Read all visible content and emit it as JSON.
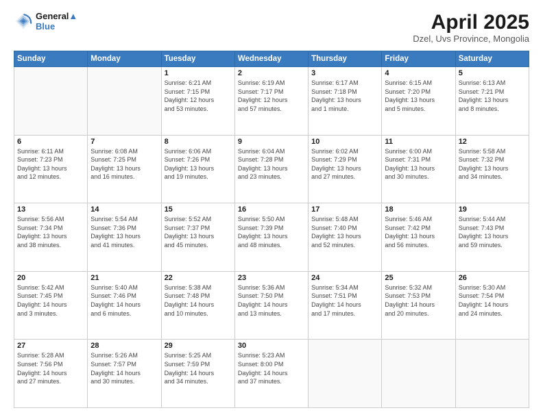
{
  "header": {
    "logo_line1": "General",
    "logo_line2": "Blue",
    "title": "April 2025",
    "subtitle": "Dzel, Uvs Province, Mongolia"
  },
  "calendar": {
    "days_of_week": [
      "Sunday",
      "Monday",
      "Tuesday",
      "Wednesday",
      "Thursday",
      "Friday",
      "Saturday"
    ],
    "weeks": [
      [
        {
          "day": "",
          "info": ""
        },
        {
          "day": "",
          "info": ""
        },
        {
          "day": "1",
          "info": "Sunrise: 6:21 AM\nSunset: 7:15 PM\nDaylight: 12 hours\nand 53 minutes."
        },
        {
          "day": "2",
          "info": "Sunrise: 6:19 AM\nSunset: 7:17 PM\nDaylight: 12 hours\nand 57 minutes."
        },
        {
          "day": "3",
          "info": "Sunrise: 6:17 AM\nSunset: 7:18 PM\nDaylight: 13 hours\nand 1 minute."
        },
        {
          "day": "4",
          "info": "Sunrise: 6:15 AM\nSunset: 7:20 PM\nDaylight: 13 hours\nand 5 minutes."
        },
        {
          "day": "5",
          "info": "Sunrise: 6:13 AM\nSunset: 7:21 PM\nDaylight: 13 hours\nand 8 minutes."
        }
      ],
      [
        {
          "day": "6",
          "info": "Sunrise: 6:11 AM\nSunset: 7:23 PM\nDaylight: 13 hours\nand 12 minutes."
        },
        {
          "day": "7",
          "info": "Sunrise: 6:08 AM\nSunset: 7:25 PM\nDaylight: 13 hours\nand 16 minutes."
        },
        {
          "day": "8",
          "info": "Sunrise: 6:06 AM\nSunset: 7:26 PM\nDaylight: 13 hours\nand 19 minutes."
        },
        {
          "day": "9",
          "info": "Sunrise: 6:04 AM\nSunset: 7:28 PM\nDaylight: 13 hours\nand 23 minutes."
        },
        {
          "day": "10",
          "info": "Sunrise: 6:02 AM\nSunset: 7:29 PM\nDaylight: 13 hours\nand 27 minutes."
        },
        {
          "day": "11",
          "info": "Sunrise: 6:00 AM\nSunset: 7:31 PM\nDaylight: 13 hours\nand 30 minutes."
        },
        {
          "day": "12",
          "info": "Sunrise: 5:58 AM\nSunset: 7:32 PM\nDaylight: 13 hours\nand 34 minutes."
        }
      ],
      [
        {
          "day": "13",
          "info": "Sunrise: 5:56 AM\nSunset: 7:34 PM\nDaylight: 13 hours\nand 38 minutes."
        },
        {
          "day": "14",
          "info": "Sunrise: 5:54 AM\nSunset: 7:36 PM\nDaylight: 13 hours\nand 41 minutes."
        },
        {
          "day": "15",
          "info": "Sunrise: 5:52 AM\nSunset: 7:37 PM\nDaylight: 13 hours\nand 45 minutes."
        },
        {
          "day": "16",
          "info": "Sunrise: 5:50 AM\nSunset: 7:39 PM\nDaylight: 13 hours\nand 48 minutes."
        },
        {
          "day": "17",
          "info": "Sunrise: 5:48 AM\nSunset: 7:40 PM\nDaylight: 13 hours\nand 52 minutes."
        },
        {
          "day": "18",
          "info": "Sunrise: 5:46 AM\nSunset: 7:42 PM\nDaylight: 13 hours\nand 56 minutes."
        },
        {
          "day": "19",
          "info": "Sunrise: 5:44 AM\nSunset: 7:43 PM\nDaylight: 13 hours\nand 59 minutes."
        }
      ],
      [
        {
          "day": "20",
          "info": "Sunrise: 5:42 AM\nSunset: 7:45 PM\nDaylight: 14 hours\nand 3 minutes."
        },
        {
          "day": "21",
          "info": "Sunrise: 5:40 AM\nSunset: 7:46 PM\nDaylight: 14 hours\nand 6 minutes."
        },
        {
          "day": "22",
          "info": "Sunrise: 5:38 AM\nSunset: 7:48 PM\nDaylight: 14 hours\nand 10 minutes."
        },
        {
          "day": "23",
          "info": "Sunrise: 5:36 AM\nSunset: 7:50 PM\nDaylight: 14 hours\nand 13 minutes."
        },
        {
          "day": "24",
          "info": "Sunrise: 5:34 AM\nSunset: 7:51 PM\nDaylight: 14 hours\nand 17 minutes."
        },
        {
          "day": "25",
          "info": "Sunrise: 5:32 AM\nSunset: 7:53 PM\nDaylight: 14 hours\nand 20 minutes."
        },
        {
          "day": "26",
          "info": "Sunrise: 5:30 AM\nSunset: 7:54 PM\nDaylight: 14 hours\nand 24 minutes."
        }
      ],
      [
        {
          "day": "27",
          "info": "Sunrise: 5:28 AM\nSunset: 7:56 PM\nDaylight: 14 hours\nand 27 minutes."
        },
        {
          "day": "28",
          "info": "Sunrise: 5:26 AM\nSunset: 7:57 PM\nDaylight: 14 hours\nand 30 minutes."
        },
        {
          "day": "29",
          "info": "Sunrise: 5:25 AM\nSunset: 7:59 PM\nDaylight: 14 hours\nand 34 minutes."
        },
        {
          "day": "30",
          "info": "Sunrise: 5:23 AM\nSunset: 8:00 PM\nDaylight: 14 hours\nand 37 minutes."
        },
        {
          "day": "",
          "info": ""
        },
        {
          "day": "",
          "info": ""
        },
        {
          "day": "",
          "info": ""
        }
      ]
    ]
  }
}
